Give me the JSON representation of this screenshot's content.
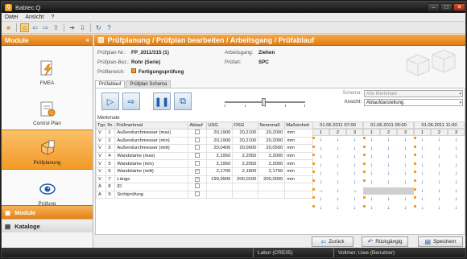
{
  "window": {
    "title": "Babtec.Q",
    "logo": "Q",
    "min": "–",
    "max": "□",
    "close": "✕"
  },
  "menu": [
    "Datei",
    "Ansicht",
    "?"
  ],
  "toolbar_icons": [
    "app-icon",
    "home-icon",
    "back-icon",
    "forward-icon",
    "up-icon",
    "next-icon",
    "down-icon",
    "refresh-icon",
    "help-icon"
  ],
  "sidebar": {
    "title": "Module",
    "items": [
      {
        "label": "FMEA",
        "icon": "fmea-icon",
        "selected": false
      },
      {
        "label": "Control Plan",
        "icon": "control-plan-icon",
        "selected": false
      },
      {
        "label": "Prüfplanung",
        "icon": "pruefplanung-icon",
        "selected": true
      },
      {
        "label": "Prüfung",
        "icon": "pruefung-icon",
        "selected": false
      }
    ],
    "nav": [
      {
        "label": "Module"
      },
      {
        "label": "Kataloge"
      }
    ]
  },
  "main": {
    "title": "Prüfplanung / Prüfplan bearbeiten / Arbeitsgang / Prüfablauf",
    "info": {
      "pruefplan_nr_label": "Prüfplan-Nr.:",
      "pruefplan_nr": "FP_2011/315 (1)",
      "bez_label": "Prüfplan-Bez.:",
      "bez": "Rohr (Serie)",
      "bereich_label": "Prüfbereich:",
      "bereich": "Fertigungsprüfung",
      "arbeitsgang_label": "Arbeitsgang:",
      "arbeitsgang": "Ziehen",
      "pruefart_label": "Prüfart:",
      "pruefart": "SPC"
    },
    "tabs": [
      "Prüfablauf",
      "Prüfplan Schema"
    ],
    "schema_label": "Schema:",
    "schema_value": "Alle Merkmale",
    "ansicht_label": "Ansicht:",
    "ansicht_value": "Ablaufdarstellung",
    "grid_title": "Merkmale",
    "columns": [
      "Typ",
      "Nr.",
      "Prüfmerkmal",
      "Ablauf",
      "USG",
      "OSG",
      "Nennmaß",
      "Maßeinheit"
    ],
    "rows": [
      [
        "V",
        "1",
        "Außendurchmesser (max)",
        "",
        "20,1900",
        "20,2100",
        "20,2000",
        "mm"
      ],
      [
        "V",
        "2",
        "Außendurchmesser (min)",
        "",
        "20,1900",
        "20,2100",
        "20,2000",
        "mm"
      ],
      [
        "V",
        "3",
        "Außendurchmesser (mitt)",
        "",
        "20,0400",
        "20,0600",
        "20,0500",
        "mm"
      ],
      [
        "V",
        "4",
        "Wandstärke (max)",
        "",
        "2,1950",
        "2,2050",
        "2,2000",
        "mm"
      ],
      [
        "V",
        "5",
        "Wandstärke (min)",
        "",
        "2,1950",
        "2,2050",
        "2,2000",
        "mm"
      ],
      [
        "V",
        "6",
        "Wandstärke (mitt)",
        "✓",
        "2,1700",
        "2,1800",
        "2,1750",
        "mm"
      ],
      [
        "V",
        "7",
        "Länge",
        "✓",
        "199,9900",
        "200,0100",
        "200,0000",
        "mm"
      ],
      [
        "A",
        "8",
        "ID",
        "",
        "",
        "",
        "",
        ""
      ],
      [
        "A",
        "9",
        "Sichtprüfung",
        "",
        "",
        "",
        "",
        ""
      ]
    ],
    "timeline": {
      "dates": [
        "01.06.2011 07:00",
        "01.06.2011 09:00",
        "01.06.2011 11:00"
      ],
      "sub": [
        "1",
        "2",
        "3",
        "1",
        "2",
        "3",
        "1",
        "2",
        "3"
      ],
      "cells": [
        [
          "↓",
          "↓",
          "↓",
          "↓",
          "↓",
          "↓",
          "↓",
          "↓",
          "↓"
        ],
        [
          "↓",
          "↓",
          "↓",
          "↓",
          "↓",
          "↓",
          "↓",
          "↓",
          "↓"
        ],
        [
          "↓",
          "↓",
          "↓",
          "↓",
          "↓",
          "↓",
          "↓",
          "↓",
          "↓"
        ],
        [
          "↓",
          "↓",
          "↓",
          "↓",
          "↓",
          "↓",
          "↓",
          "↓",
          "↓"
        ],
        [
          "↓",
          "↓",
          "↓",
          "↓",
          "↓",
          "↓",
          "↓",
          "↓",
          "↓"
        ],
        [
          "↓",
          "↓",
          "↓",
          "↓",
          "↓",
          "↓",
          "↓",
          "↓",
          "↓"
        ],
        [
          "→",
          "↓",
          "→",
          "",
          "",
          "",
          "↓",
          "↓",
          "↓"
        ],
        [
          "↓",
          "↓",
          "↓",
          "↓",
          "↓",
          "↓",
          "↓",
          "↓",
          "↓"
        ],
        [
          "↓",
          "↓",
          "↓",
          "↓",
          "↓",
          "↓",
          "↓",
          "↓",
          "↓"
        ]
      ]
    },
    "buttons": {
      "back": "Zurück",
      "undo": "Rückgängig",
      "save": "Speichern"
    }
  },
  "status": {
    "location": "Labor (CRE05)",
    "user": "Vollmer, Uwe (Benutzer)"
  },
  "colors": {
    "accent": "#f29a26",
    "arrow": "#1c5aa8"
  }
}
